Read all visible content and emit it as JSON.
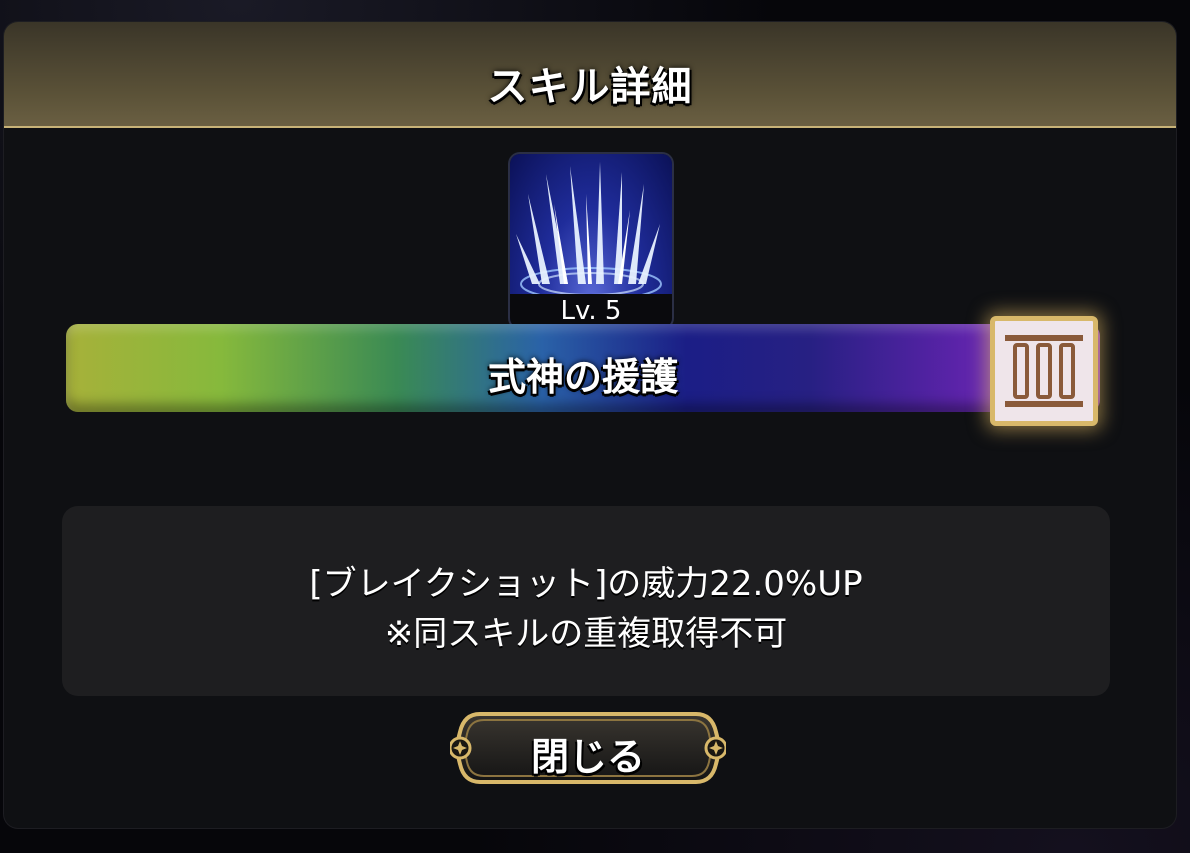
{
  "dialog": {
    "title": "スキル詳細"
  },
  "skill": {
    "icon": "spikes-burst-icon",
    "level": "Lv. 5",
    "name": "式神の援護",
    "rank": "III",
    "rank_icon": "roman-numeral-three-icon"
  },
  "description": {
    "lines": [
      "[ブレイクショット]の威力22.0%UP",
      "※同スキルの重複取得不可"
    ]
  },
  "buttons": {
    "close_label": "閉じる"
  },
  "colors": {
    "header": "#5b5238",
    "gold_accent": "#d8b86a",
    "panel": "#0f1013",
    "description_bg": "#1e1e20",
    "icon_blue": "#1f2c9a"
  }
}
